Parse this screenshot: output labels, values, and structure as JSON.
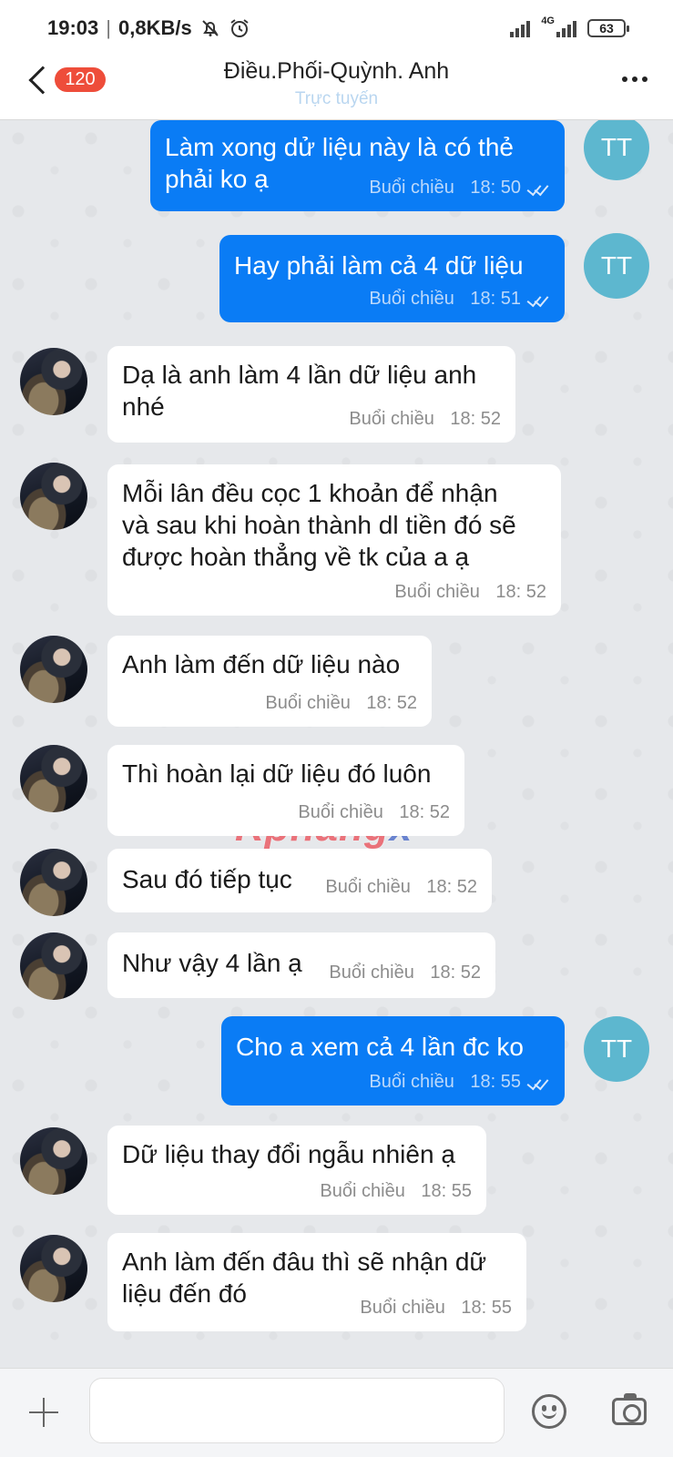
{
  "status_bar": {
    "time": "19:03",
    "separator": "|",
    "speed": "0,8KB/s",
    "network": "4G",
    "battery": "63"
  },
  "header": {
    "unread_count": "120",
    "title": "Điều.Phối-Quỳnh. Anh",
    "subtitle": "Trực tuyến"
  },
  "watermark": {
    "main": "Rphang",
    "accent": "x"
  },
  "messages": [
    {
      "from": "me",
      "avatar": "TT",
      "lines": [
        "Làm xong dử liệu này là có thẻ",
        "phải ko ạ"
      ],
      "period": "Buổi chiều",
      "time": "18: 50"
    },
    {
      "from": "me",
      "avatar": "TT",
      "lines": [
        "Hay phải làm cả 4 dữ liệu"
      ],
      "period": "Buổi chiều",
      "time": "18: 51"
    },
    {
      "from": "them",
      "lines": [
        "Dạ là anh làm 4 lần dữ liệu anh",
        "nhé"
      ],
      "period": "Buổi chiều",
      "time": "18: 52"
    },
    {
      "from": "them",
      "lines": [
        "Mỗi lân đều cọc 1 khoản để nhận",
        "và sau khi hoàn thành dl tiền đó sẽ",
        "được hoàn thẳng về tk của a ạ"
      ],
      "period": "Buổi chiều",
      "time": "18: 52"
    },
    {
      "from": "them",
      "lines": [
        "Anh làm đến dữ liệu nào"
      ],
      "period": "Buổi chiều",
      "time": "18: 52"
    },
    {
      "from": "them",
      "lines": [
        "Thì hoàn lại dữ liệu đó luôn"
      ],
      "period": "Buổi chiều",
      "time": "18: 52"
    },
    {
      "from": "them",
      "lines": [
        "Sau đó tiếp tục"
      ],
      "period": "Buổi chiều",
      "time": "18: 52"
    },
    {
      "from": "them",
      "lines": [
        "Như vậy 4 lần ạ"
      ],
      "period": "Buổi chiều",
      "time": "18: 52"
    },
    {
      "from": "me",
      "avatar": "TT",
      "lines": [
        "Cho a xem cả 4 lần đc ko"
      ],
      "period": "Buổi chiều",
      "time": "18: 55"
    },
    {
      "from": "them",
      "lines": [
        "Dữ liệu thay đổi ngẫu nhiên ạ"
      ],
      "period": "Buổi chiều",
      "time": "18: 55"
    },
    {
      "from": "them",
      "lines": [
        "Anh làm đến đâu thì sẽ nhận dữ",
        "liệu đến đó"
      ],
      "period": "Buổi chiều",
      "time": "18: 55"
    }
  ],
  "input": {
    "placeholder": ""
  },
  "icons": {
    "back": "chevron-left-icon",
    "more": "more-dots-icon",
    "add": "plus-icon",
    "emoji": "smiley-icon",
    "camera": "camera-icon"
  }
}
